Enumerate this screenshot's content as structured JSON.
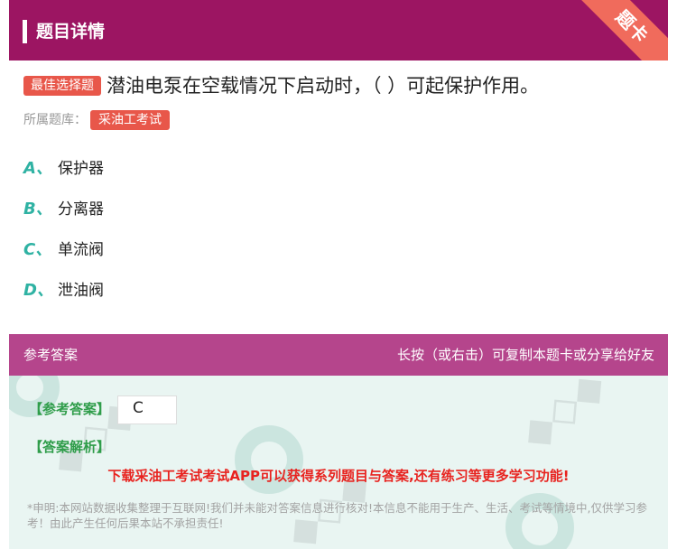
{
  "header": {
    "title": "题目详情",
    "ribbon": "题卡"
  },
  "question": {
    "type_tag": "最佳选择题",
    "text": "潜油电泵在空载情况下启动时，（ ）可起保护作用。",
    "bank_label": "所属题库：",
    "bank_name": "采油工考试"
  },
  "options": [
    {
      "letter": "A、",
      "text": "保护器"
    },
    {
      "letter": "B、",
      "text": "分离器"
    },
    {
      "letter": "C、",
      "text": "单流阀"
    },
    {
      "letter": "D、",
      "text": "泄油阀"
    }
  ],
  "answer": {
    "section_title": "参考答案",
    "share_hint": "长按（或右击）可复制本题卡或分享给好友",
    "ref_label": "【参考答案】",
    "ref_value": "C",
    "analysis_label": "【答案解析】",
    "promo": "下载采油工考试考试APP可以获得系列题目与答案,还有练习等更多学习功能!",
    "disclaimer": "*申明:本网站数据收集整理于互联网!我们并未能对答案信息进行核对!本信息不能用于生产、生活、考试等情境中,仅供学习参考！由此产生任何后果本站不承担责任!"
  },
  "colors": {
    "header_bg": "#9c1562",
    "answer_header_bg": "#b5458c",
    "tag_red": "#e8574a",
    "option_letter": "#2fb2a3",
    "answer_green": "#2f9d4a",
    "promo_red": "#e8231f"
  }
}
